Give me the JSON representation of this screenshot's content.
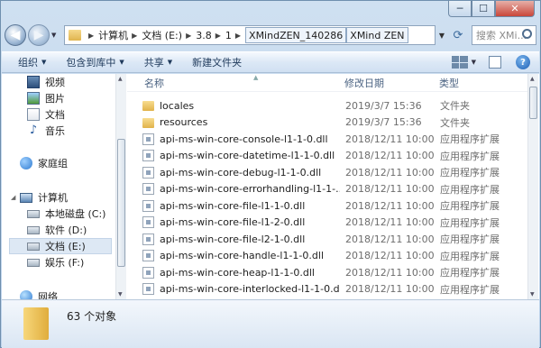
{
  "window": {
    "caption_minimize": "─",
    "caption_maximize": "☐",
    "caption_close": "✕"
  },
  "address": {
    "back": "◀",
    "forward": "▶",
    "crumbs": [
      "计算机",
      "文档 (E:)",
      "3.8",
      "1",
      "XMindZEN_140286",
      "XMind ZEN"
    ],
    "search_placeholder": "搜索 XMi..."
  },
  "toolbar": {
    "organize": "组织",
    "include_in_library": "包含到库中",
    "share": "共享",
    "new_folder": "新建文件夹"
  },
  "nav": {
    "libraries": [
      "视频",
      "图片",
      "文档",
      "音乐"
    ],
    "homegroup": "家庭组",
    "computer": "计算机",
    "drives": [
      "本地磁盘 (C:)",
      "软件 (D:)",
      "文档 (E:)",
      "娱乐 (F:)"
    ],
    "network": "网络"
  },
  "columns": {
    "name": "名称",
    "date": "修改日期",
    "type": "类型"
  },
  "files": [
    {
      "name": "locales",
      "date": "2019/3/7 15:36",
      "type": "文件夹",
      "kind": "folder"
    },
    {
      "name": "resources",
      "date": "2019/3/7 15:36",
      "type": "文件夹",
      "kind": "folder"
    },
    {
      "name": "api-ms-win-core-console-l1-1-0.dll",
      "date": "2018/12/11 10:00",
      "type": "应用程序扩展",
      "kind": "dll"
    },
    {
      "name": "api-ms-win-core-datetime-l1-1-0.dll",
      "date": "2018/12/11 10:00",
      "type": "应用程序扩展",
      "kind": "dll"
    },
    {
      "name": "api-ms-win-core-debug-l1-1-0.dll",
      "date": "2018/12/11 10:00",
      "type": "应用程序扩展",
      "kind": "dll"
    },
    {
      "name": "api-ms-win-core-errorhandling-l1-1-...",
      "date": "2018/12/11 10:00",
      "type": "应用程序扩展",
      "kind": "dll"
    },
    {
      "name": "api-ms-win-core-file-l1-1-0.dll",
      "date": "2018/12/11 10:00",
      "type": "应用程序扩展",
      "kind": "dll"
    },
    {
      "name": "api-ms-win-core-file-l1-2-0.dll",
      "date": "2018/12/11 10:00",
      "type": "应用程序扩展",
      "kind": "dll"
    },
    {
      "name": "api-ms-win-core-file-l2-1-0.dll",
      "date": "2018/12/11 10:00",
      "type": "应用程序扩展",
      "kind": "dll"
    },
    {
      "name": "api-ms-win-core-handle-l1-1-0.dll",
      "date": "2018/12/11 10:00",
      "type": "应用程序扩展",
      "kind": "dll"
    },
    {
      "name": "api-ms-win-core-heap-l1-1-0.dll",
      "date": "2018/12/11 10:00",
      "type": "应用程序扩展",
      "kind": "dll"
    },
    {
      "name": "api-ms-win-core-interlocked-l1-1-0.dll",
      "date": "2018/12/11 10:00",
      "type": "应用程序扩展",
      "kind": "dll"
    }
  ],
  "status": {
    "count": "63 个对象"
  }
}
